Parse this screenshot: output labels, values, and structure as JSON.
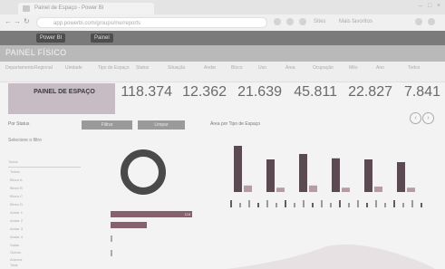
{
  "browser": {
    "tab_title": "Painel de Espaço - Power BI",
    "url": "app.powerbi.com/groups/me/reports",
    "bookmarks": [
      "Sites",
      "Mais favoritos"
    ]
  },
  "header": {
    "chip_1": "Power BI",
    "chip_2": "Painel",
    "title": "PAINEL FÍSICO"
  },
  "filters": [
    "Departamento",
    "Regional",
    "Unidade",
    "Tipo de Espaço",
    "Status",
    "Situação",
    "Andar",
    "Bloco",
    "Uso",
    "Área",
    "Ocupação",
    "Mês",
    "Ano",
    "Todos"
  ],
  "kpi_panel": {
    "title": "PAINEL DE ESPAÇO",
    "values": [
      "118.374",
      "12.362",
      "21.639",
      "45.811",
      "22.827",
      "7.841"
    ]
  },
  "nav": {
    "prev": "‹",
    "next": "›"
  },
  "sections": {
    "left_title": "Por Status",
    "btn_1": "Filtrar",
    "btn_2": "Limpar",
    "right_title": "Área por Tipo de Espaço"
  },
  "filter_panel": {
    "title": "Selecione o filtro",
    "select_label": "Todos",
    "items": [
      "Todos",
      "Bloco A",
      "Bloco B",
      "Bloco C",
      "Bloco D",
      "Andar 1",
      "Andar 2",
      "Andar 3",
      "Andar 4",
      "Salas",
      "Outros",
      "Anexos",
      "Total"
    ]
  },
  "hbars": {
    "value_1": "118"
  },
  "colors": {
    "accent": "#8a5f6e",
    "gray": "#9e9e9e",
    "header": "#7a7a7a"
  },
  "chart_data": [
    {
      "type": "pie",
      "title": "",
      "values": [
        100
      ],
      "note": "donut"
    },
    {
      "type": "bar",
      "title": "",
      "categories": [
        "",
        "",
        "",
        "",
        "",
        "",
        "",
        "",
        "",
        "",
        "",
        ""
      ],
      "series": [
        {
          "values": [
            85,
            60,
            70,
            62,
            60,
            55
          ]
        },
        {
          "values": [
            12,
            8,
            12,
            8,
            10,
            8
          ]
        }
      ]
    }
  ]
}
